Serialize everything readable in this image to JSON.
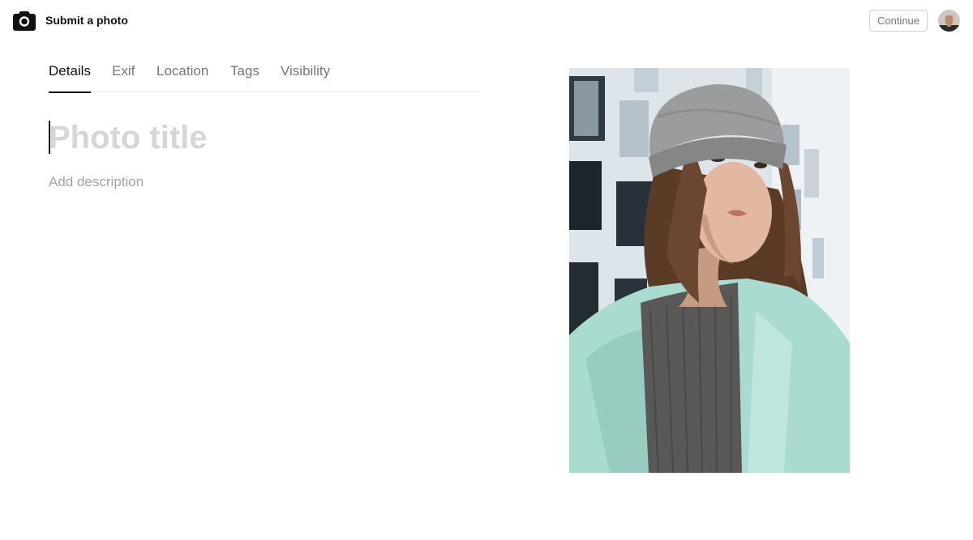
{
  "header": {
    "title": "Submit a photo",
    "continue_label": "Continue",
    "logo_icon": "camera-icon",
    "avatar_icon": "user-avatar"
  },
  "tabs": [
    {
      "label": "Details",
      "active": true
    },
    {
      "label": "Exif",
      "active": false
    },
    {
      "label": "Location",
      "active": false
    },
    {
      "label": "Tags",
      "active": false
    },
    {
      "label": "Visibility",
      "active": false
    }
  ],
  "form": {
    "title_value": "",
    "title_placeholder": "Photo title",
    "description_value": "",
    "description_placeholder": "Add description"
  },
  "photo": {
    "subject": "woman-in-beanie-portrait"
  },
  "colors": {
    "text": "#111111",
    "muted": "#767676",
    "placeholder_title": "#d6d6d6",
    "placeholder_desc": "#a3a3a3",
    "border": "#d1d1d1",
    "coat": "#a9dbd0",
    "sweater": "#5a5856",
    "beanie": "#9b9d9c"
  }
}
